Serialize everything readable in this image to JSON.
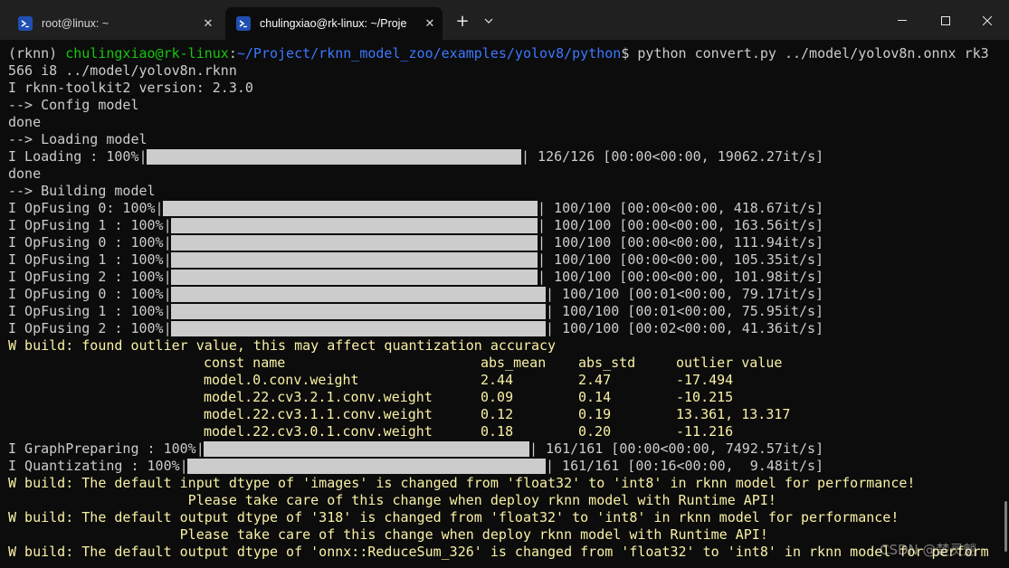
{
  "tabs": [
    {
      "label": "root@linux: ~",
      "icon": "terminal-icon",
      "active": false
    },
    {
      "label": "chulingxiao@rk-linux: ~/Proje",
      "icon": "terminal-icon",
      "active": true
    }
  ],
  "prompt": {
    "env": "(rknn) ",
    "user_host": "chulingxiao@rk-linux",
    "sep": ":",
    "path": "~/Project/rknn_model_zoo/examples/yolov8/python",
    "dollar": "$",
    "command": " python convert.py ../model/yolov8n.onnx rk3",
    "command_cont": "566 i8 ../model/yolov8n.rknn"
  },
  "lines": {
    "version": "I rknn-toolkit2 version: 2.3.0",
    "config": "--> Config model",
    "done1": "done",
    "loading": "--> Loading model",
    "done2": "done",
    "building": "--> Building model"
  },
  "progress": [
    {
      "label": "I Loading : 100%|",
      "stats": "| 126/126 [00:00<00:00, 19062.27it/s]"
    },
    {
      "label": "I OpFusing 0: 100%|",
      "stats": "| 100/100 [00:00<00:00, 418.67it/s]"
    },
    {
      "label": "I OpFusing 1 : 100%|",
      "stats": "| 100/100 [00:00<00:00, 163.56it/s]"
    },
    {
      "label": "I OpFusing 0 : 100%|",
      "stats": "| 100/100 [00:00<00:00, 111.94it/s]"
    },
    {
      "label": "I OpFusing 1 : 100%|",
      "stats": "| 100/100 [00:00<00:00, 105.35it/s]"
    },
    {
      "label": "I OpFusing 2 : 100%|",
      "stats": "| 100/100 [00:00<00:00, 101.98it/s]"
    },
    {
      "label": "I OpFusing 0 : 100%|",
      "stats": "| 100/100 [00:01<00:00, 79.17it/s]"
    },
    {
      "label": "I OpFusing 1 : 100%|",
      "stats": "| 100/100 [00:01<00:00, 75.95it/s]"
    },
    {
      "label": "I OpFusing 2 : 100%|",
      "stats": "| 100/100 [00:02<00:00, 41.36it/s]"
    },
    {
      "label": "I GraphPreparing : 100%|",
      "stats": "| 161/161 [00:00<00:00, 7492.57it/s]"
    },
    {
      "label": "I Quantizating : 100%|",
      "stats": "| 161/161 [00:16<00:00,  9.48it/s]"
    }
  ],
  "outlier": {
    "warning": "W build: found outlier value, this may affect quantization accuracy",
    "headers": [
      "const name",
      "abs_mean",
      "abs_std",
      "outlier value"
    ],
    "rows": [
      [
        "model.0.conv.weight",
        "2.44",
        "2.47",
        "-17.494"
      ],
      [
        "model.22.cv3.2.1.conv.weight",
        "0.09",
        "0.14",
        "-10.215"
      ],
      [
        "model.22.cv3.1.1.conv.weight",
        "0.12",
        "0.19",
        "13.361, 13.317"
      ],
      [
        "model.22.cv3.0.1.conv.weight",
        "0.18",
        "0.20",
        "-11.216"
      ]
    ]
  },
  "warnings": [
    "W build: The default input dtype of 'images' is changed from 'float32' to 'int8' in rknn model for performance!",
    "                      Please take care of this change when deploy rknn model with Runtime API!",
    "W build: The default output dtype of '318' is changed from 'float32' to 'int8' in rknn model for performance!",
    "                     Please take care of this change when deploy rknn model with Runtime API!",
    "W build: The default output dtype of 'onnx::ReduceSum_326' is changed from 'float32' to 'int8' in rknn model for perform"
  ],
  "watermark": "CSDN @楚灵魈",
  "colors": {
    "green": "#16c60c",
    "blue": "#3b78ff",
    "yellow": "#f9f1a5",
    "text": "#cccccc",
    "bg": "#0c0c0c"
  }
}
